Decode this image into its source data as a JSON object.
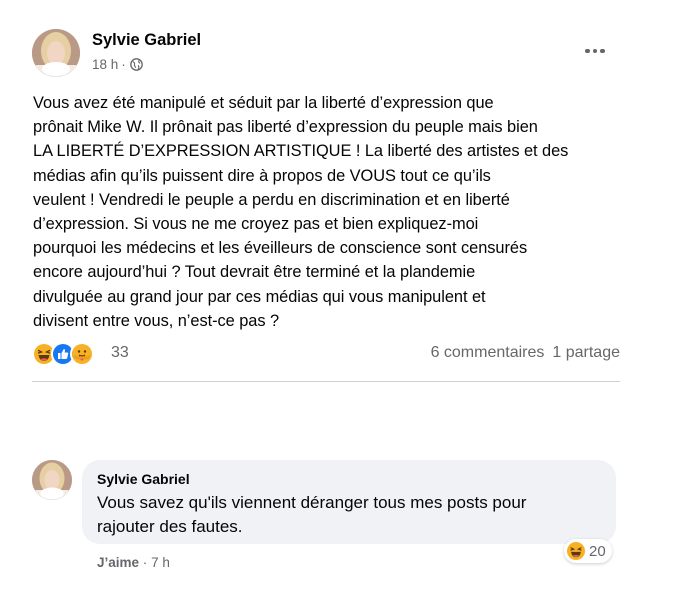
{
  "post": {
    "author": "Sylvie Gabriel",
    "time": "18 h",
    "separator": "·",
    "privacy_icon": "globe-icon",
    "more_icon": "more-horizontal-icon",
    "text_lines": [
      "Vous avez été manipulé et séduit par la liberté d’expression que",
      "prônait Mike W. Il prônait pas liberté d’expression du peuple mais bien",
      "LA LIBERTÉ D’EXPRESSION ARTISTIQUE ! La liberté des artistes et des",
      "médias afin qu’ils puissent dire à propos de VOUS tout ce qu’ils",
      "veulent ! Vendredi le peuple a perdu en discrimination et en liberté",
      "d’expression. Si vous ne me croyez pas et bien expliquez-moi",
      "pourquoi les médecins et les éveilleurs de conscience sont censurés",
      "encore aujourd’hui ? Tout devrait être terminé et la plandemie",
      "divulguée au grand jour par ces médias qui vous manipulent et",
      "divisent entre vous, n’est-ce pas ?"
    ]
  },
  "stats": {
    "reactions": [
      "haha-reaction-icon",
      "like-reaction-icon",
      "care-reaction-icon"
    ],
    "reaction_count": "33",
    "comments": "6 commentaires",
    "shares": "1 partage"
  },
  "comment": {
    "author": "Sylvie Gabriel",
    "text_lines": [
      "Vous savez qu'ils viennent déranger tous mes posts pour",
      "rajouter des fautes."
    ],
    "reaction": "haha-reaction-icon",
    "reaction_count": "20",
    "like_label": "J’aime",
    "separator": "·",
    "time": "7 h"
  },
  "colors": {
    "text_primary": "#050505",
    "text_secondary": "#65676b",
    "bubble_bg": "#f0f2f5",
    "like_blue": "#1877f2",
    "haha_yellow": "#f7b125",
    "divider": "#ced0d4"
  }
}
